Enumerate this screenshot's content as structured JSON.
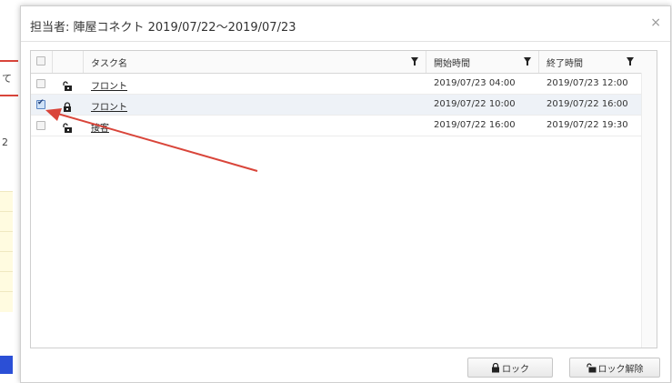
{
  "background": {
    "fragment_text": "て",
    "fragment_number": "2"
  },
  "dialog": {
    "title": "担当者: 陣屋コネクト 2019/07/22〜2019/07/23",
    "close_label": "×"
  },
  "table": {
    "columns": {
      "name": "タスク名",
      "start": "開始時間",
      "end": "終了時間"
    },
    "rows": [
      {
        "checked": false,
        "locked": false,
        "name": "フロント",
        "start": "2019/07/23 04:00",
        "end": "2019/07/23 12:00"
      },
      {
        "checked": true,
        "locked": true,
        "name": "フロント",
        "start": "2019/07/22 10:00",
        "end": "2019/07/22 16:00"
      },
      {
        "checked": false,
        "locked": false,
        "name": "接客",
        "start": "2019/07/22 16:00",
        "end": "2019/07/22 19:30"
      }
    ]
  },
  "buttons": {
    "lock": "ロック",
    "unlock": "ロック解除"
  },
  "colors": {
    "annotation_arrow": "#d9453a",
    "checked_fill": "#cfe2f7"
  }
}
